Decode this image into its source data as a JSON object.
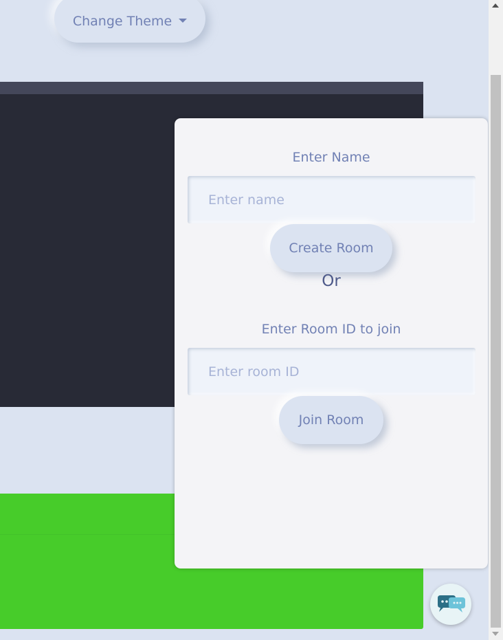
{
  "header": {
    "theme_button_label": "Change Theme"
  },
  "room_panel": {
    "name_label": "Enter Name",
    "name_placeholder": "Enter name",
    "create_button": "Create Room",
    "or_text": "Or",
    "room_id_label": "Enter Room ID to join",
    "room_id_placeholder": "Enter room ID",
    "join_button": "Join Room"
  },
  "colors": {
    "background": "#dbe3f1",
    "editor": "#282a36",
    "editor_header": "#44475a",
    "output": "#47cc2a",
    "panel": "#f4f4f7",
    "accent_text": "#7181b4"
  },
  "icons": {
    "chat": "chat-bubbles-icon",
    "theme_caret": "caret-down-icon"
  }
}
